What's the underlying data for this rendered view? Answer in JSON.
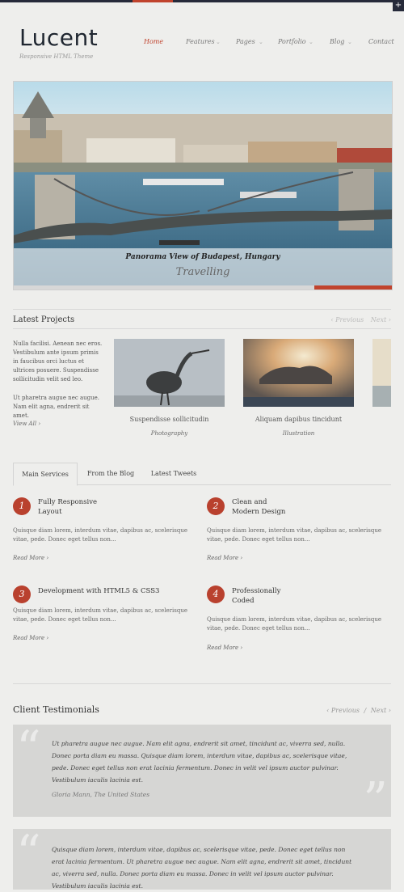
{
  "brand": {
    "name": "Lucent",
    "tagline": "Responsive HTML Theme"
  },
  "nav": {
    "items": [
      {
        "label": "Home",
        "active": true
      },
      {
        "label": "Features"
      },
      {
        "label": "Pages"
      },
      {
        "label": "Portfolio"
      },
      {
        "label": "Blog"
      },
      {
        "label": "Contact"
      }
    ],
    "caret": "⌄"
  },
  "hero": {
    "title": "Panorama View of Budapest, Hungary",
    "subtitle": "Travelling",
    "progress": 0.2
  },
  "projects": {
    "title": "Latest Projects",
    "prev": "Previous",
    "next": "Next",
    "intro_1": "Nulla facilisi. Aenean nec eros. Vestibulum ante ipsum primis in faucibus orci luctus et ultrices posuere. Suspendisse sollicitudin velit sed leo.",
    "intro_2": "Ut pharetra augue nec augue. Nam elit agna, endrerit sit amet.",
    "view_all": "View All",
    "items": [
      {
        "caption": "Suspendisse sollicitudin",
        "category": "Photography"
      },
      {
        "caption": "Aliquam dapibus tincidunt",
        "category": "Illustration"
      }
    ]
  },
  "tabs": [
    {
      "label": "Main Services",
      "active": true
    },
    {
      "label": "From the Blog"
    },
    {
      "label": "Latest Tweets"
    }
  ],
  "services": [
    {
      "num": "1",
      "title_1": "Fully Responsive",
      "title_2": "Layout",
      "body": "Quisque diam lorem, interdum vitae, dapibus ac, scelerisque vitae, pede. Donec eget tellus non...",
      "more": "Read More"
    },
    {
      "num": "2",
      "title_1": "Clean and",
      "title_2": "Modern Design",
      "body": "Quisque diam lorem, interdum vitae, dapibus ac, scelerisque vitae, pede. Donec eget tellus non...",
      "more": "Read More"
    },
    {
      "num": "3",
      "title_1": "Development with HTML5 & CSS3",
      "title_2": "",
      "body": "Quisque diam lorem, interdum vitae, dapibus ac, scelerisque vitae, pede. Donec eget tellus non...",
      "more": "Read More"
    },
    {
      "num": "4",
      "title_1": "Professionally",
      "title_2": "Coded",
      "body": "Quisque diam lorem, interdum vitae, dapibus ac, scelerisque vitae, pede. Donec eget tellus non...",
      "more": "Read More"
    }
  ],
  "testimonials": {
    "title": "Client Testimonials",
    "prev": "Previous",
    "next": "Next",
    "items": [
      {
        "text": "Ut pharetra augue nec augue. Nam elit agna, endrerit sit amet, tincidunt ac, viverra sed, nulla. Donec porta diam eu massa. Quisque diam lorem, interdum vitae, dapibus ac, scelerisque vitae, pede. Donec eget tellus non erat lacinia fermentum. Donec in velit vel ipsum auctor pulvinar. Vestibulum iaculis lacinia est.",
        "author": "Gloria Mann, The United States"
      },
      {
        "text": "Quisque diam lorem, interdum vitae, dapibus ac, scelerisque vitae, pede. Donec eget tellus non erat lacinia fermentum. Ut pharetra augue nec augue. Nam elit agna, endrerit sit amet, tincidunt ac, viverra sed, nulla. Donec porta diam eu massa. Donec in velit vel ipsum auctor pulvinar. Vestibulum iaculis lacinia est."
      }
    ]
  },
  "colors": {
    "accent": "#c0432d",
    "dark": "#262a3a",
    "background": "#eeeeec"
  }
}
